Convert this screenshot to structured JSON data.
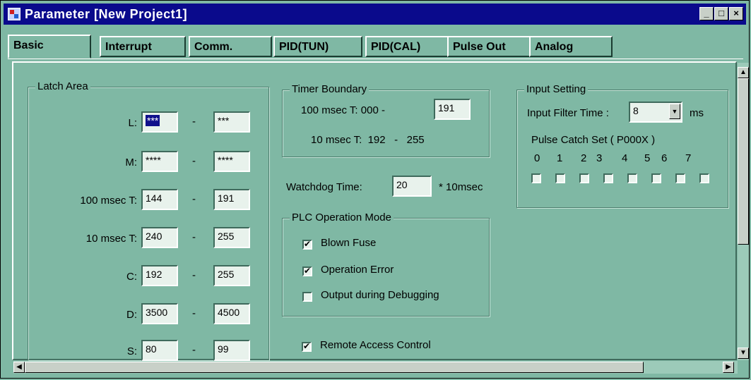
{
  "window": {
    "title": "Parameter [New Project1]",
    "buttons": [
      "_",
      "□",
      "×"
    ]
  },
  "tabs": [
    "Basic",
    "Interrupt",
    "Comm.",
    "PID(TUN)",
    "PID(CAL)",
    "Pulse Out",
    "Analog"
  ],
  "active_tab": "Basic",
  "latch_area": {
    "title": "Latch Area",
    "dash": "-",
    "rows": [
      {
        "label": "L:",
        "from": "***",
        "to": "***"
      },
      {
        "label": "M:",
        "from": "****",
        "to": "****"
      },
      {
        "label": "100 msec T:",
        "from": "144",
        "to": "191"
      },
      {
        "label": "10 msec T:",
        "from": "240",
        "to": "255"
      },
      {
        "label": "C:",
        "from": "192",
        "to": "255"
      },
      {
        "label": "D:",
        "from": "3500",
        "to": "4500"
      },
      {
        "label": "S:",
        "from": "80",
        "to": "99"
      }
    ]
  },
  "timer_boundary": {
    "title": "Timer Boundary",
    "row1_label": "100 msec T:  000  -",
    "row1_value": "191",
    "row2_label": "10 msec T:  192   -   255"
  },
  "watchdog": {
    "label": "Watchdog Time:",
    "value": "20",
    "unit": "* 10msec"
  },
  "plc_mode": {
    "title": "PLC Operation Mode",
    "options": [
      {
        "label": "Blown Fuse",
        "checked": true
      },
      {
        "label": "Operation Error",
        "checked": true
      },
      {
        "label": "Output during Debugging",
        "checked": false
      }
    ]
  },
  "remote_access": {
    "label": "Remote Access Control",
    "checked": true
  },
  "input_setting": {
    "title": "Input Setting",
    "filter_label": "Input Filter Time :",
    "filter_value": "8",
    "filter_unit": "ms",
    "pulse_catch_label": "Pulse Catch Set ( P000X )",
    "bits": [
      "0",
      "1",
      "2",
      "3",
      "4",
      "5",
      "6",
      "7"
    ]
  },
  "colors": {
    "titlebar": "#0a0a8c",
    "background": "#7fb8a4",
    "field": "#e8f2ec"
  }
}
